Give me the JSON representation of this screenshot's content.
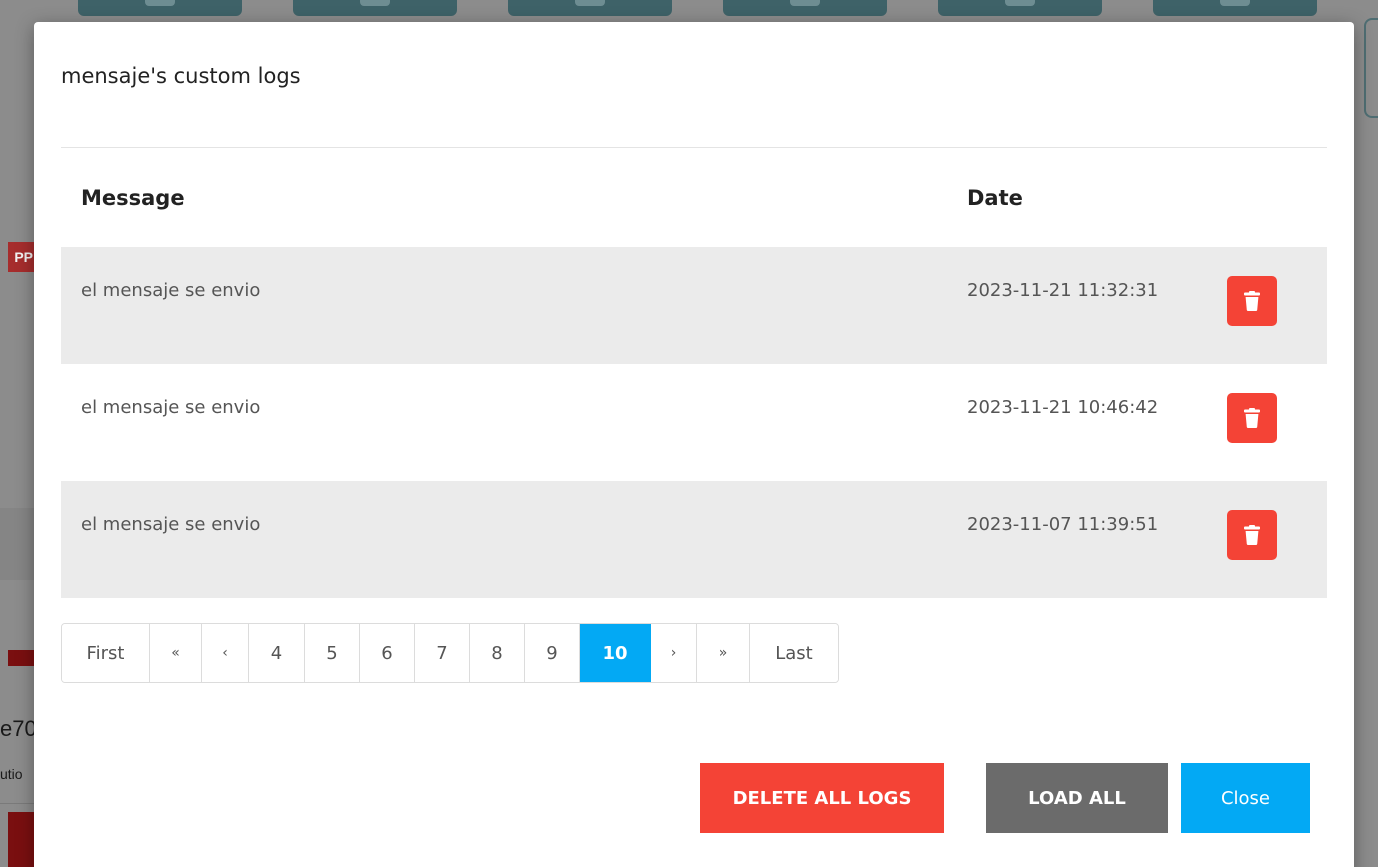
{
  "modal": {
    "title": "mensaje's custom logs"
  },
  "table": {
    "headers": {
      "message": "Message",
      "date": "Date"
    },
    "rows": [
      {
        "message": "el mensaje se envio",
        "date": "2023-11-21 11:32:31"
      },
      {
        "message": "el mensaje se envio",
        "date": "2023-11-21 10:46:42"
      },
      {
        "message": "el mensaje se envio",
        "date": "2023-11-07 11:39:51"
      }
    ],
    "delete_row_icon": "trash-icon"
  },
  "pagination": {
    "first": "First",
    "prev_block": "«",
    "prev": "‹",
    "pages": [
      "4",
      "5",
      "6",
      "7",
      "8",
      "9",
      "10"
    ],
    "current_page": "10",
    "next": "›",
    "next_block": "»",
    "last": "Last"
  },
  "footer": {
    "delete_all_label": "DELETE ALL LOGS",
    "load_all_label": "LOAD ALL",
    "close_label": "Close"
  },
  "background": {
    "badge_text": "PP",
    "card_title_text": "e70",
    "card_subtitle_text": "utio"
  },
  "colors": {
    "danger": "#f44336",
    "primary": "#03a9f4",
    "secondary": "#6b6b6b",
    "row_shade": "#ebebeb",
    "overlay": "#8c8c8c"
  }
}
